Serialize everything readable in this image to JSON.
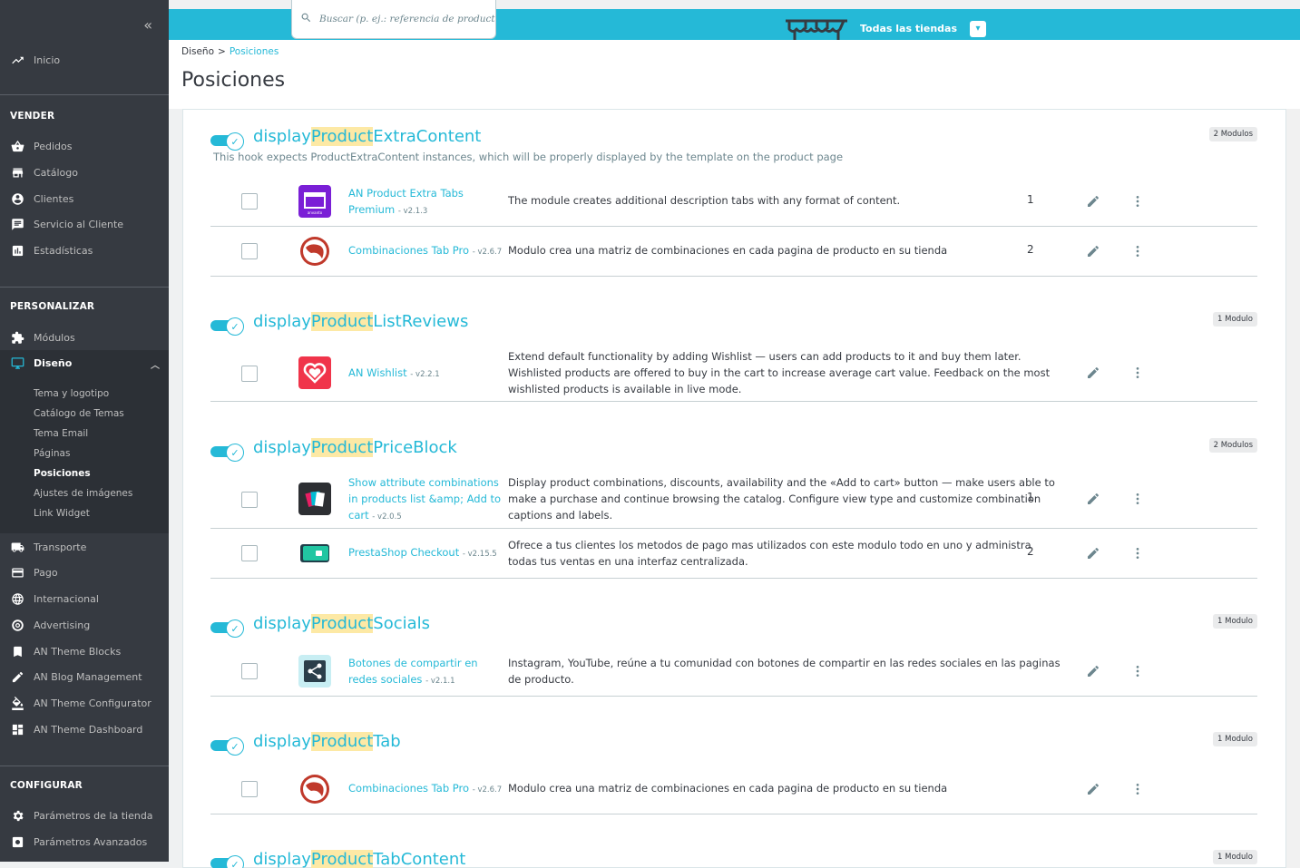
{
  "sidebar": {
    "collapse_icon": "double-chevron-left-icon",
    "home": "Inicio",
    "sections": {
      "sell": "VENDER",
      "customize": "PERSONALIZAR",
      "configure": "CONFIGURAR"
    },
    "sell_items": [
      "Pedidos",
      "Catálogo",
      "Clientes",
      "Servicio al Cliente",
      "Estadísticas"
    ],
    "customize_items": [
      "Módulos",
      "Diseño"
    ],
    "design_sub": [
      "Tema y logotipo",
      "Catálogo de Temas",
      "Tema Email",
      "Páginas",
      "Posiciones",
      "Ajustes de imágenes",
      "Link Widget"
    ],
    "more_items": [
      "Transporte",
      "Pago",
      "Internacional",
      "Advertising",
      "AN Theme Blocks",
      "AN Blog Management",
      "AN Theme Configurator",
      "AN Theme Dashboard"
    ],
    "configure_items": [
      "Parámetros de la tienda",
      "Parámetros Avanzados"
    ]
  },
  "topbar": {
    "search_placeholder": "Buscar (p. ej.: referencia de producto,",
    "shop_label": "Todas las tiendas",
    "accent": "#25b9d7"
  },
  "header": {
    "breadcrumb_parent": "Diseño",
    "breadcrumb_sep": ">",
    "breadcrumb_current": "Posiciones",
    "title": "Posiciones"
  },
  "hooks": [
    {
      "pre": "display",
      "hl": "Product",
      "post": "ExtraContent",
      "badge": "2 Modulos",
      "desc": "This hook expects ProductExtraContent instances, which will be properly displayed by the template on the product page"
    },
    {
      "pre": "display",
      "hl": "Product",
      "post": "ListReviews",
      "badge": "1 Modulo"
    },
    {
      "pre": "display",
      "hl": "Product",
      "post": "PriceBlock",
      "badge": "2 Modulos"
    },
    {
      "pre": "display",
      "hl": "Product",
      "post": "Socials",
      "badge": "1 Modulo"
    },
    {
      "pre": "display",
      "hl": "Product",
      "post": "Tab",
      "badge": "1 Modulo"
    },
    {
      "pre": "display",
      "hl": "Product",
      "post": "TabContent",
      "badge": "1 Modulo"
    }
  ],
  "modules": [
    {
      "name": "AN Product Extra Tabs Premium",
      "version": "- v2.1.3",
      "desc": "The module creates additional description tabs with any format of content.",
      "pos": "1"
    },
    {
      "name": "Combinaciones Tab Pro",
      "version": "- v2.6.7",
      "desc": "Modulo crea una matriz de combinaciones en cada pagina de producto en su tienda",
      "pos": "2"
    },
    {
      "name": "AN Wishlist",
      "version": "- v2.2.1",
      "desc": "Extend default functionality by adding Wishlist — users can add products to it and buy them later. Wishlisted products are offered to buy in the cart to increase average cart value. Feedback on the most wishlisted products is available in live mode.",
      "pos": ""
    },
    {
      "name": "Show attribute combinations in products list &amp; Add to cart",
      "version": "- v2.0.5",
      "desc": "Display product combinations, discounts, availability and the «Add to cart» button — make users able to make a purchase and continue browsing the catalog. Configure view type and customize combination captions and labels.",
      "pos": "1"
    },
    {
      "name": "PrestaShop Checkout",
      "version": "- v2.15.5",
      "desc": "Ofrece a tus clientes los metodos de pago mas utilizados con este modulo todo en uno y administra todas tus ventas en una interfaz centralizada.",
      "pos": "2"
    },
    {
      "name": "Botones de compartir en redes sociales",
      "version": "- v2.1.1",
      "desc": "Instagram, YouTube, reúne a tu comunidad con botones de compartir en las redes sociales en las paginas de producto.",
      "pos": ""
    },
    {
      "name": "Combinaciones Tab Pro",
      "version": "- v2.6.7",
      "desc": "Modulo crea una matriz de combinaciones en cada pagina de producto en su tienda",
      "pos": ""
    }
  ]
}
